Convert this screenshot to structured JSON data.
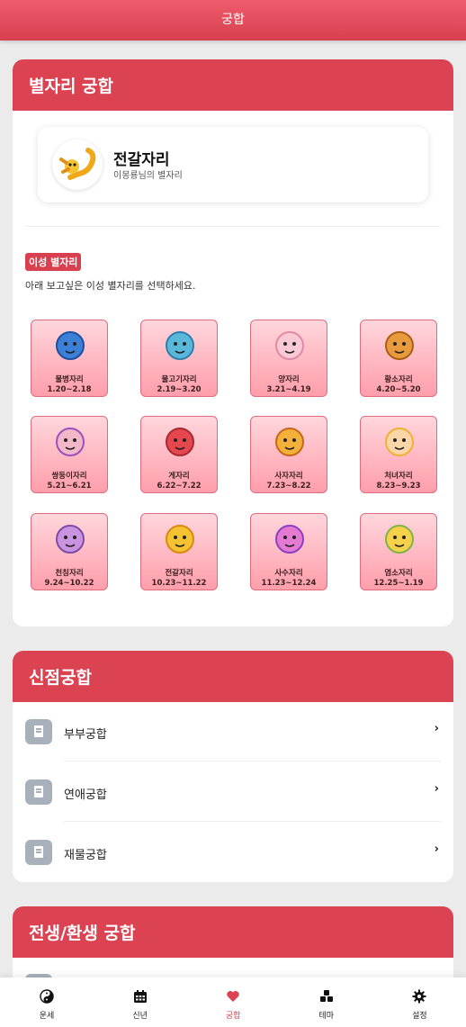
{
  "header": {
    "title": "궁합"
  },
  "zodiac_card": {
    "title": "별자리 궁합",
    "my_sign": {
      "name": "전갈자리",
      "subtitle": "이몽룡님의 별자리"
    },
    "badge": "이성 별자리",
    "instruction": "아래 보고싶은 이성 별자리를 선택하세요.",
    "signs": [
      {
        "name": "물병자리",
        "dates": "1.20~2.18",
        "icon": "aquarius-icon"
      },
      {
        "name": "물고기자리",
        "dates": "2.19~3.20",
        "icon": "pisces-icon"
      },
      {
        "name": "양자리",
        "dates": "3.21~4.19",
        "icon": "aries-icon"
      },
      {
        "name": "황소자리",
        "dates": "4.20~5.20",
        "icon": "taurus-icon"
      },
      {
        "name": "쌍둥이자리",
        "dates": "5.21~6.21",
        "icon": "gemini-icon"
      },
      {
        "name": "게자리",
        "dates": "6.22~7.22",
        "icon": "cancer-icon"
      },
      {
        "name": "사자자리",
        "dates": "7.23~8.22",
        "icon": "leo-icon"
      },
      {
        "name": "처녀자리",
        "dates": "8.23~9.23",
        "icon": "virgo-icon"
      },
      {
        "name": "천칭자리",
        "dates": "9.24~10.22",
        "icon": "libra-icon"
      },
      {
        "name": "전갈자리",
        "dates": "10.23~11.22",
        "icon": "scorpio-icon"
      },
      {
        "name": "사수자리",
        "dates": "11.23~12.24",
        "icon": "sagittarius-icon"
      },
      {
        "name": "염소자리",
        "dates": "12.25~1.19",
        "icon": "capricorn-icon"
      }
    ]
  },
  "shinjeom_card": {
    "title": "신점궁합",
    "items": [
      {
        "label": "부부궁합",
        "icon": "document-icon"
      },
      {
        "label": "연애궁합",
        "icon": "document-icon"
      },
      {
        "label": "재물궁합",
        "icon": "document-icon"
      }
    ]
  },
  "past_life_card": {
    "title": "전생/환생 궁합"
  },
  "tabbar": {
    "items": [
      {
        "label": "운세",
        "icon": "yin-yang-icon"
      },
      {
        "label": "신년",
        "icon": "calendar-icon"
      },
      {
        "label": "궁합",
        "icon": "heart-icon"
      },
      {
        "label": "테마",
        "icon": "cubes-icon"
      },
      {
        "label": "설정",
        "icon": "gear-icon"
      }
    ],
    "active_index": 2
  },
  "colors": {
    "accent": "#db4352",
    "tile_top": "#ffd6dc",
    "tile_bottom": "#ff9eab",
    "icon_gray": "#a8b0ba"
  }
}
